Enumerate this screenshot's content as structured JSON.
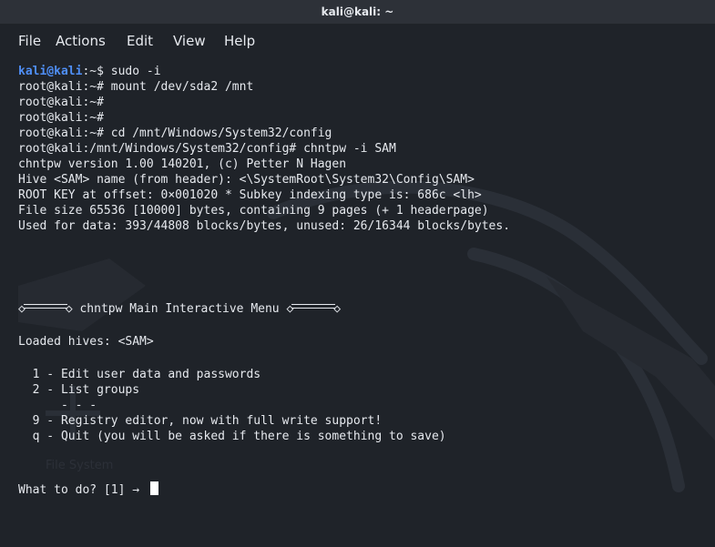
{
  "window": {
    "title": "kali@kali: ~"
  },
  "menu": {
    "items": [
      "File",
      "Actions",
      "Edit",
      "View",
      "Help"
    ]
  },
  "colors": {
    "background": "#1f2329",
    "text": "#e6e9ee",
    "prompt_user": "#4f8ff7"
  },
  "terminal": {
    "first_prompt_user": "kali@kali",
    "first_prompt_path": ":~$ ",
    "first_command": "sudo -i",
    "lines": [
      "root@kali:~# mount /dev/sda2 /mnt",
      "root@kali:~#",
      "root@kali:~#",
      "root@kali:~# cd /mnt/Windows/System32/config",
      "root@kali:/mnt/Windows/System32/config# chntpw -i SAM",
      "chntpw version 1.00 140201, (c) Petter N Hagen",
      "Hive <SAM> name (from header): <\\SystemRoot\\System32\\Config\\SAM>",
      "ROOT KEY at offset: 0×001020 * Subkey indexing type is: 686c <lh>",
      "File size 65536 [10000] bytes, containing 9 pages (+ 1 headerpage)",
      "Used for data: 393/44808 blocks/bytes, unused: 26/16344 blocks/bytes."
    ],
    "menu_left_glyph": "◇",
    "menu_arrow_glyph": "◇",
    "menu_title": " chntpw Main Interactive Menu ",
    "loaded_hives": "Loaded hives: <SAM>",
    "options": [
      "  1 - Edit user data and passwords",
      "  2 - List groups",
      "      - - -",
      "  9 - Registry editor, now with full write support!",
      "  q - Quit (you will be asked if there is something to save)"
    ],
    "input_prompt": "What to do? [1] → "
  }
}
